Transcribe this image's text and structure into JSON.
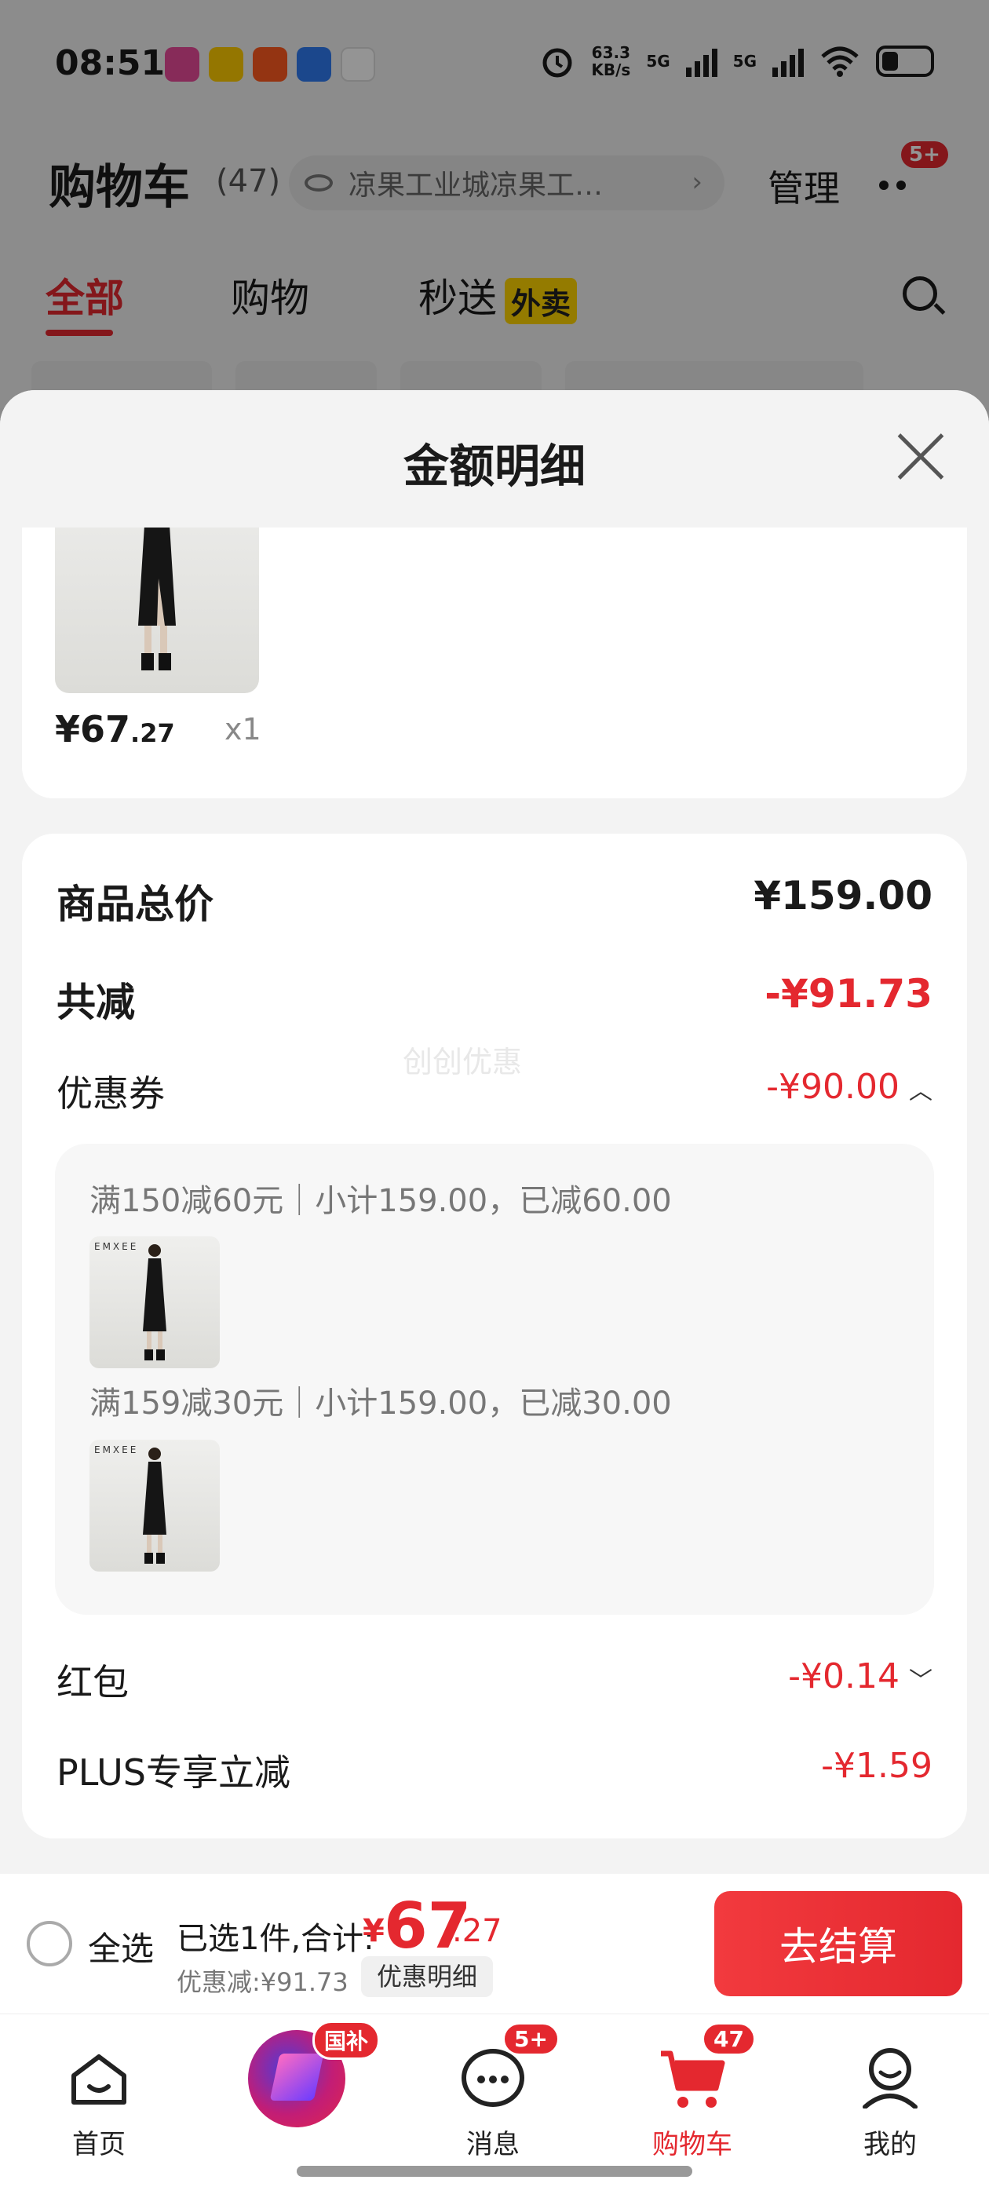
{
  "status_bar": {
    "time": "08:51",
    "net_speed_value": "63.3",
    "net_speed_unit": "KB/s",
    "signal_1": "5G",
    "signal_2": "5G"
  },
  "background_page": {
    "title": "购物车",
    "count": "(47)",
    "address": "凉果工业城凉果工…",
    "manage_label": "管理",
    "more_badge": "5+",
    "tabs": [
      {
        "label": "全部",
        "active": true
      },
      {
        "label": "购物",
        "active": false
      },
      {
        "label": "秒送",
        "active": false,
        "tag": "外卖"
      }
    ]
  },
  "sheet": {
    "title": "金额明细",
    "product": {
      "price_int": "¥67",
      "price_dec": ".27",
      "qty": "x1"
    },
    "summary": {
      "total_label": "商品总价",
      "total_value": "¥159.00",
      "discount_label": "共减",
      "discount_value": "-¥91.73",
      "coupon_label": "优惠券",
      "coupon_value": "-¥90.00",
      "watermark": "创创优惠",
      "coupons": [
        {
          "text": "满150减60元｜小计159.00，已减60.00"
        },
        {
          "text": "满159减30元｜小计159.00，已减30.00"
        }
      ],
      "thumb_brand": "EMXEE",
      "redpacket_label": "红包",
      "redpacket_value": "-¥0.14",
      "plus_label": "PLUS专享立减",
      "plus_value": "-¥1.59"
    }
  },
  "checkout": {
    "select_all_label": "全选",
    "selected_text": "已选1件,合计:",
    "total_currency": "¥",
    "total_int": "67",
    "total_dec": ".27",
    "saved_text": "优惠减:¥91.73",
    "detail_button": "优惠明细",
    "checkout_button": "去结算"
  },
  "tabbar": {
    "items": [
      {
        "label": "首页",
        "icon": "home-icon"
      },
      {
        "label": "",
        "icon": "promo-icon",
        "badge": "国补"
      },
      {
        "label": "消息",
        "icon": "message-icon",
        "badge": "5+"
      },
      {
        "label": "购物车",
        "icon": "cart-icon",
        "badge": "47",
        "active": true
      },
      {
        "label": "我的",
        "icon": "profile-icon"
      }
    ]
  },
  "colors": {
    "accent_red": "#e4282f",
    "yellow_tag": "#ffd400"
  }
}
